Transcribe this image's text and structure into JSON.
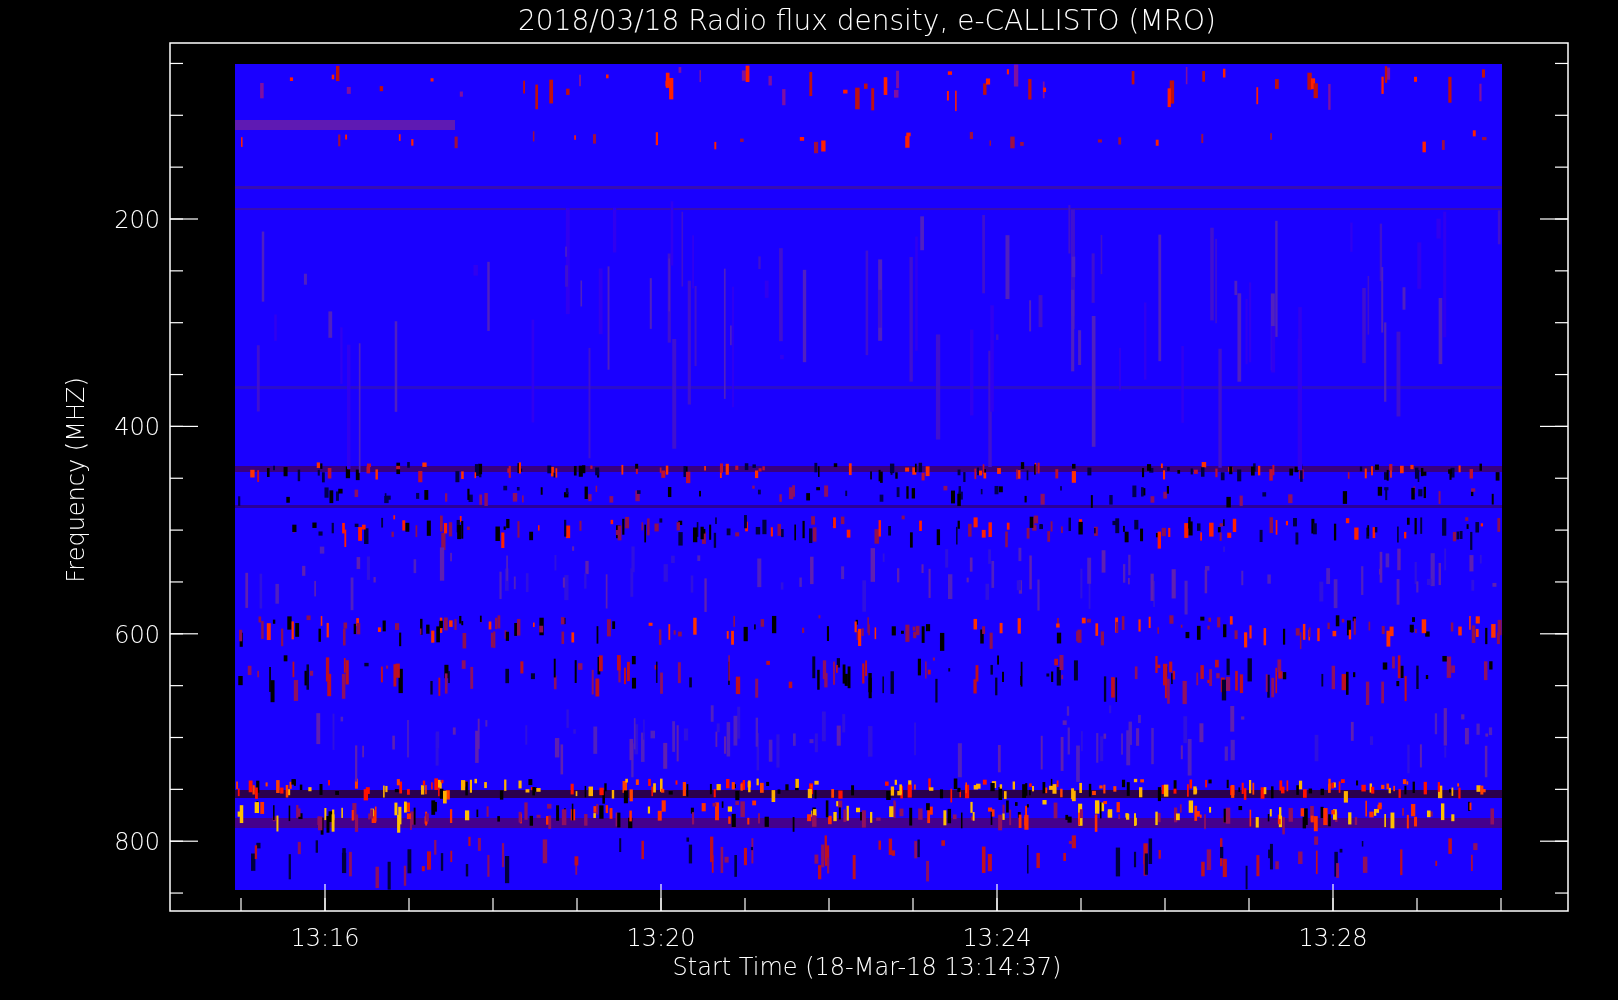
{
  "title": "2018/03/18  Radio flux density, e-CALLISTO (MRO)",
  "ylabel": "Frequency (MHZ)",
  "xlabel": "Start Time (18-Mar-18 13:14:37)",
  "yticks": [
    "200",
    "400",
    "600",
    "800"
  ],
  "xticks": [
    "13:16",
    "13:20",
    "13:24",
    "13:28"
  ]
}
